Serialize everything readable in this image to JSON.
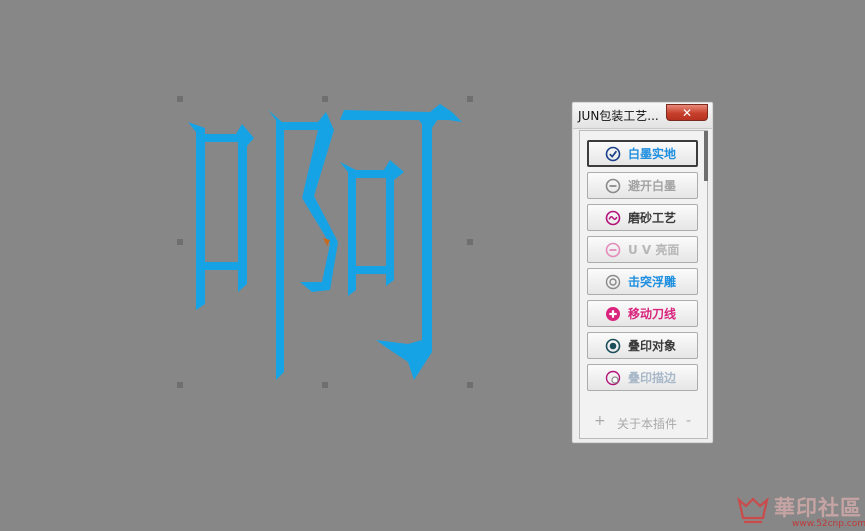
{
  "canvas": {
    "glyph_text": "啊",
    "glyph_color": "#16a3e6",
    "background": "#878787"
  },
  "panel": {
    "title": "JUN包装工艺...",
    "close_glyph": "✕",
    "buttons": [
      {
        "label": "白墨实地",
        "color": "#1f8fe0",
        "icon": "check-circle-icon"
      },
      {
        "label": "避开白墨",
        "color": "#a3a3a3",
        "icon": "minus-circle-icon"
      },
      {
        "label": "磨砂工艺",
        "color": "#3a3a3a",
        "icon": "wave-circle-icon"
      },
      {
        "label": "U V 亮面",
        "color": "#b7b7b7",
        "icon": "minus-circle-pink-icon"
      },
      {
        "label": "击突浮雕",
        "color": "#1f8fe0",
        "icon": "target-circle-icon"
      },
      {
        "label": "移动刀线",
        "color": "#d9237d",
        "icon": "plus-circle-icon"
      },
      {
        "label": "叠印对象",
        "color": "#3a3a3a",
        "icon": "dot-circle-icon"
      },
      {
        "label": "叠印描边",
        "color": "#a8b8c8",
        "icon": "ring-circle-icon"
      }
    ],
    "about": {
      "plus": "+",
      "label": "关于本插件",
      "minus": "-"
    }
  },
  "watermark": {
    "text": "華印社區",
    "url": "www.52cnp.com"
  }
}
